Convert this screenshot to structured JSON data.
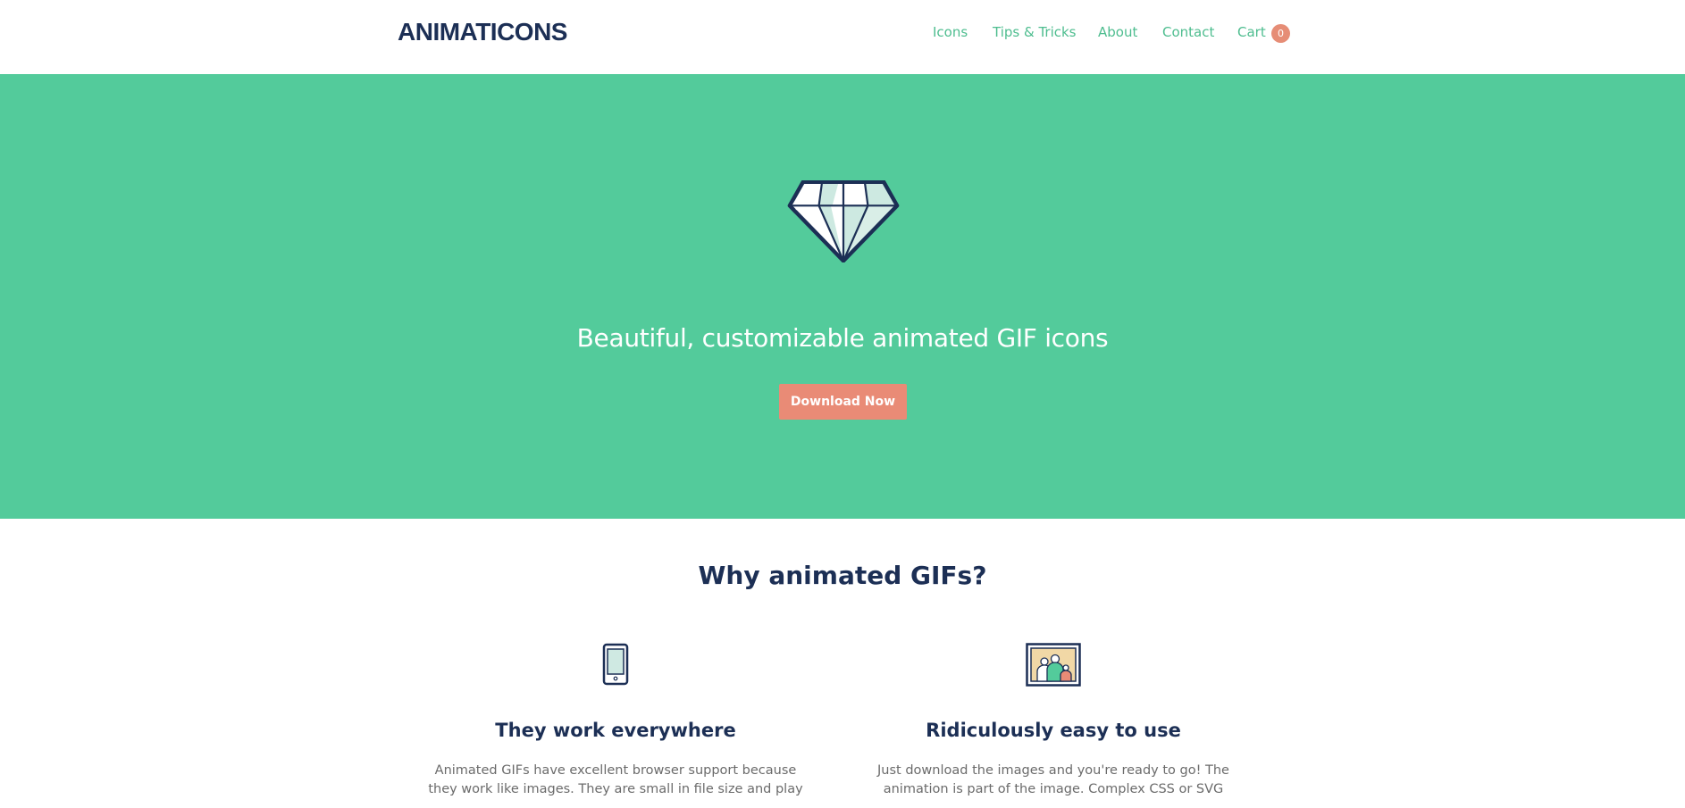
{
  "nav": {
    "logo": "ANIMATICONS",
    "items": [
      {
        "label": "Icons"
      },
      {
        "label": "Tips & Tricks"
      },
      {
        "label": "About"
      },
      {
        "label": "Contact"
      },
      {
        "label": "Cart"
      }
    ],
    "cart_count": "0"
  },
  "hero": {
    "icon": "diamond-icon",
    "title": "Beautiful, customizable animated GIF icons",
    "button_label": "Download Now"
  },
  "why": {
    "title": "Why animated GIFs?",
    "features": [
      {
        "icon": "tablet-icon",
        "title": "They work everywhere",
        "text": "Animated GIFs have excellent browser support because they work like images. They are small in file size and play"
      },
      {
        "icon": "picture-frame-icon",
        "title": "Ridiculously easy to use",
        "text": "Just download the images and you're ready to go! The animation is part of the image. Complex CSS or SVG"
      }
    ]
  },
  "colors": {
    "hero_bg": "#53cb9b",
    "accent": "#e98b76",
    "navy": "#1c2f55",
    "nav_link": "#4ebd8f"
  }
}
